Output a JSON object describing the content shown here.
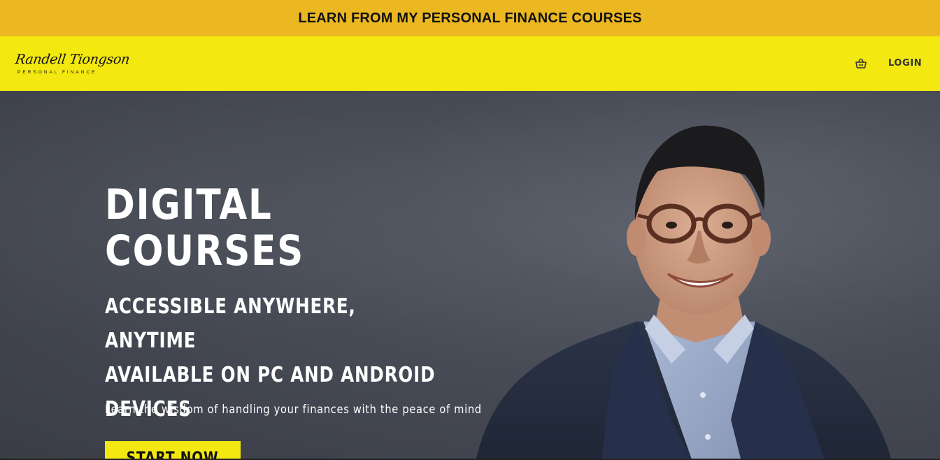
{
  "announcement": {
    "text": "LEARN FROM MY PERSONAL FINANCE COURSES"
  },
  "header": {
    "logo": {
      "name": "Randell Tiongson",
      "subtitle": "PERSONAL FINANCE"
    },
    "cart_icon": "shopping-basket-icon",
    "login_label": "LOGIN"
  },
  "hero": {
    "heading_line1": "DIGITAL",
    "heading_line2": "COURSES",
    "sub_line1": "ACCESSIBLE ANYWHERE, ANYTIME",
    "sub_line2": "AVAILABLE ON PC AND ANDROID",
    "sub_line3": "DEVICES",
    "tagline": "Learn the wisdom of handling your finances with the peace of mind",
    "cta_label": "START NOW"
  },
  "colors": {
    "announcement_bg": "#ecb822",
    "header_bg": "#f3e80f",
    "hero_bg": "#474b55",
    "cta_bg": "#f3e80f",
    "text_light": "#ffffff",
    "text_dark": "#111111"
  }
}
